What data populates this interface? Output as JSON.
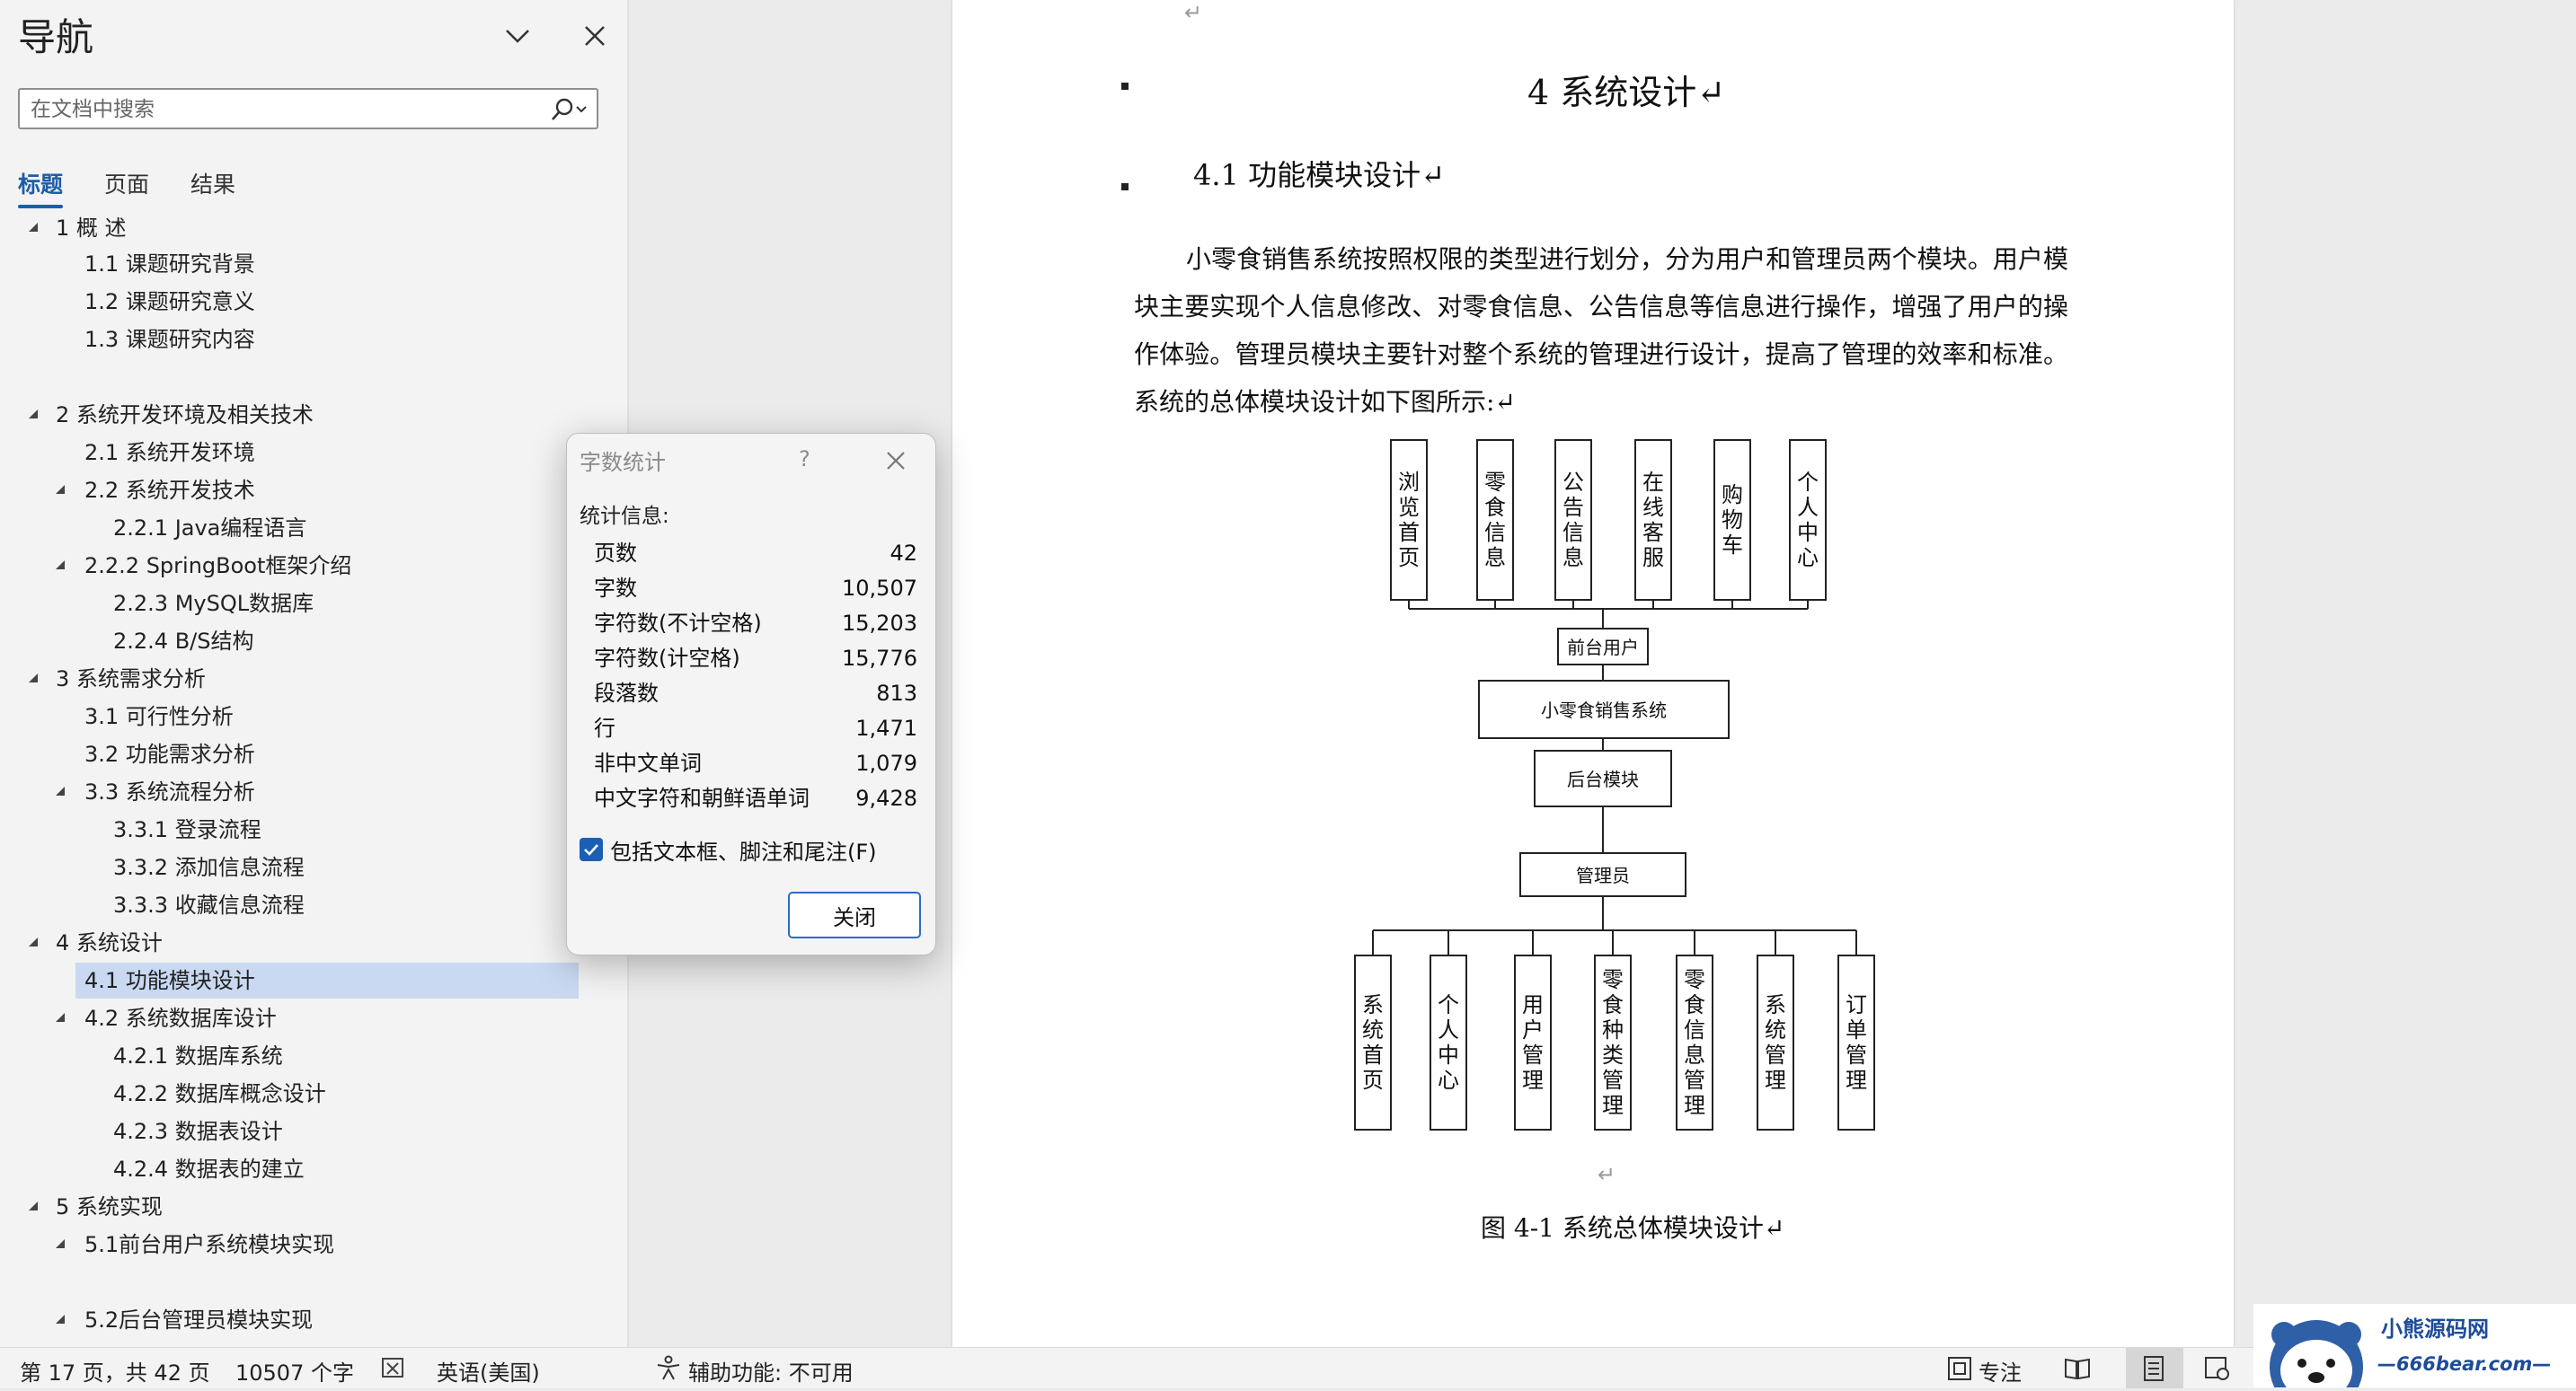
{
  "nav": {
    "title": "导航",
    "search_placeholder": "在文档中搜索",
    "tabs": [
      "标题",
      "页面",
      "结果"
    ],
    "headings": [
      {
        "text": "1  概  述",
        "level": 1,
        "expanded": true
      },
      {
        "text": "1.1 课题研究背景",
        "level": 2
      },
      {
        "text": "1.2 课题研究意义",
        "level": 2
      },
      {
        "text": "1.3 课题研究内容",
        "level": 2
      },
      {
        "text": "2  系统开发环境及相关技术",
        "level": 1,
        "expanded": true
      },
      {
        "text": "2.1 系统开发环境",
        "level": 2
      },
      {
        "text": "2.2 系统开发技术",
        "level": 2,
        "expanded": true
      },
      {
        "text": "2.2.1 Java编程语言",
        "level": 3
      },
      {
        "text": "2.2.2  SpringBoot框架介绍",
        "level": 2,
        "expanded": true
      },
      {
        "text": "2.2.3 MySQL数据库",
        "level": 3
      },
      {
        "text": "2.2.4 B/S结构",
        "level": 3
      },
      {
        "text": "3  系统需求分析",
        "level": 1,
        "expanded": true
      },
      {
        "text": "3.1 可行性分析",
        "level": 2
      },
      {
        "text": "3.2 功能需求分析",
        "level": 2
      },
      {
        "text": "3.3 系统流程分析",
        "level": 2,
        "expanded": true
      },
      {
        "text": "3.3.1 登录流程",
        "level": 3
      },
      {
        "text": "3.3.2 添加信息流程",
        "level": 3
      },
      {
        "text": "3.3.3 收藏信息流程",
        "level": 3
      },
      {
        "text": "4  系统设计",
        "level": 1,
        "expanded": true
      },
      {
        "text": "4.1 功能模块设计",
        "level": 2,
        "selected": true
      },
      {
        "text": "4.2 系统数据库设计",
        "level": 2,
        "expanded": true
      },
      {
        "text": "4.2.1 数据库系统",
        "level": 3
      },
      {
        "text": "4.2.2 数据库概念设计",
        "level": 3
      },
      {
        "text": "4.2.3 数据表设计",
        "level": 3
      },
      {
        "text": "4.2.4 数据表的建立",
        "level": 3
      },
      {
        "text": "5  系统实现",
        "level": 1,
        "expanded": true
      },
      {
        "text": "5.1前台用户系统模块实现",
        "level": 2,
        "expanded": true
      },
      {
        "text": "5.2后台管理员模块实现",
        "level": 2,
        "expanded": true
      }
    ]
  },
  "document": {
    "chapter_title": "4    系统设计↵",
    "section_title": "4.1  功能模块设计↵",
    "return_mark": "↵",
    "body": "小零食销售系统按照权限的类型进行划分，分为用户和管理员两个模块。用户模块主要实现个人信息修改、对零食信息、公告信息等信息进行操作，增强了用户的操作体验。管理员模块主要针对整个系统的管理进行设计，提高了管理的效率和标准。系统的总体模块设计如下图所示:↵",
    "figure_caption": "图 4-1  系统总体模块设计↵",
    "diagram": {
      "top_modules": [
        "浏览首页",
        "零食信息",
        "公告信息",
        "在线客服",
        "购物车",
        "个人中心"
      ],
      "front_user": "前台用户",
      "system": "小零食销售系统",
      "backend": "后台模块",
      "admin": "管理员",
      "bottom_modules": [
        "系统首页",
        "个人中心",
        "用户管理",
        "零食种类管理",
        "零食信息管理",
        "系统管理",
        "订单管理"
      ]
    }
  },
  "dialog": {
    "title": "字数统计",
    "help": "?",
    "stats_label": "统计信息:",
    "stats": [
      {
        "label": "页数",
        "value": "42"
      },
      {
        "label": "字数",
        "value": "10,507"
      },
      {
        "label": "字符数(不计空格)",
        "value": "15,203"
      },
      {
        "label": "字符数(计空格)",
        "value": "15,776"
      },
      {
        "label": "段落数",
        "value": "813"
      },
      {
        "label": "行",
        "value": "1,471"
      },
      {
        "label": "非中文单词",
        "value": "1,079"
      },
      {
        "label": "中文字符和朝鲜语单词",
        "value": "9,428"
      }
    ],
    "include_label": "包括文本框、脚注和尾注(F)",
    "include_checked": true,
    "close_label": "关闭"
  },
  "statusbar": {
    "page": "第 17 页，共 42 页",
    "words": "10507 个字",
    "language": "英语(美国)",
    "accessibility": "辅助功能: 不可用",
    "focus": "专注"
  },
  "logo": {
    "name": "小熊源码网",
    "url": "—666bear.com—"
  }
}
